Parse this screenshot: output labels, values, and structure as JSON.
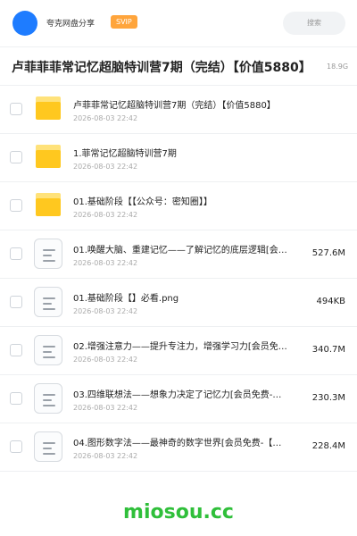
{
  "header": {
    "user_name": "夸克网盘分享",
    "badge": "SVIP",
    "search_label": "搜索"
  },
  "title_bar": {
    "title": "卢菲菲菲常记忆超脑特训营7期（完结）【价值5880】",
    "total_size": "18.9G"
  },
  "files": [
    {
      "type": "folder",
      "name": "卢菲菲常记忆超脑特训营7期（完结）【价值5880】",
      "date": "2026-08-03 22:42",
      "size": ""
    },
    {
      "type": "folder",
      "name": "1.菲常记忆超脑特训营7期",
      "date": "2026-08-03 22:42",
      "size": ""
    },
    {
      "type": "folder",
      "name": "01.基础阶段【【公众号：密知圈】】",
      "date": "2026-08-03 22:42",
      "size": ""
    },
    {
      "type": "file",
      "name": "01.唤醒大脑、重建记忆——了解记忆的底层逻辑[会…",
      "date": "2026-08-03 22:42",
      "size": "527.6M"
    },
    {
      "type": "file",
      "name": "01.基础阶段【】必看.png",
      "date": "2026-08-03 22:42",
      "size": "494KB"
    },
    {
      "type": "file",
      "name": "02.增强注意力——提升专注力，增强学习力[会员免…",
      "date": "2026-08-03 22:42",
      "size": "340.7M"
    },
    {
      "type": "file",
      "name": "03.四维联想法——想象力决定了记忆力[会员免费-…",
      "date": "2026-08-03 22:42",
      "size": "230.3M"
    },
    {
      "type": "file",
      "name": "04.图形数字法——最神奇的数字世界[会员免费-【…",
      "date": "2026-08-03 22:42",
      "size": "228.4M"
    }
  ],
  "watermark": "miosou.cc",
  "colors": {
    "avatar": "#1e7cff",
    "badge": "#ffa53c",
    "folder": "#ffc81f",
    "watermark": "#2fbf3a"
  }
}
